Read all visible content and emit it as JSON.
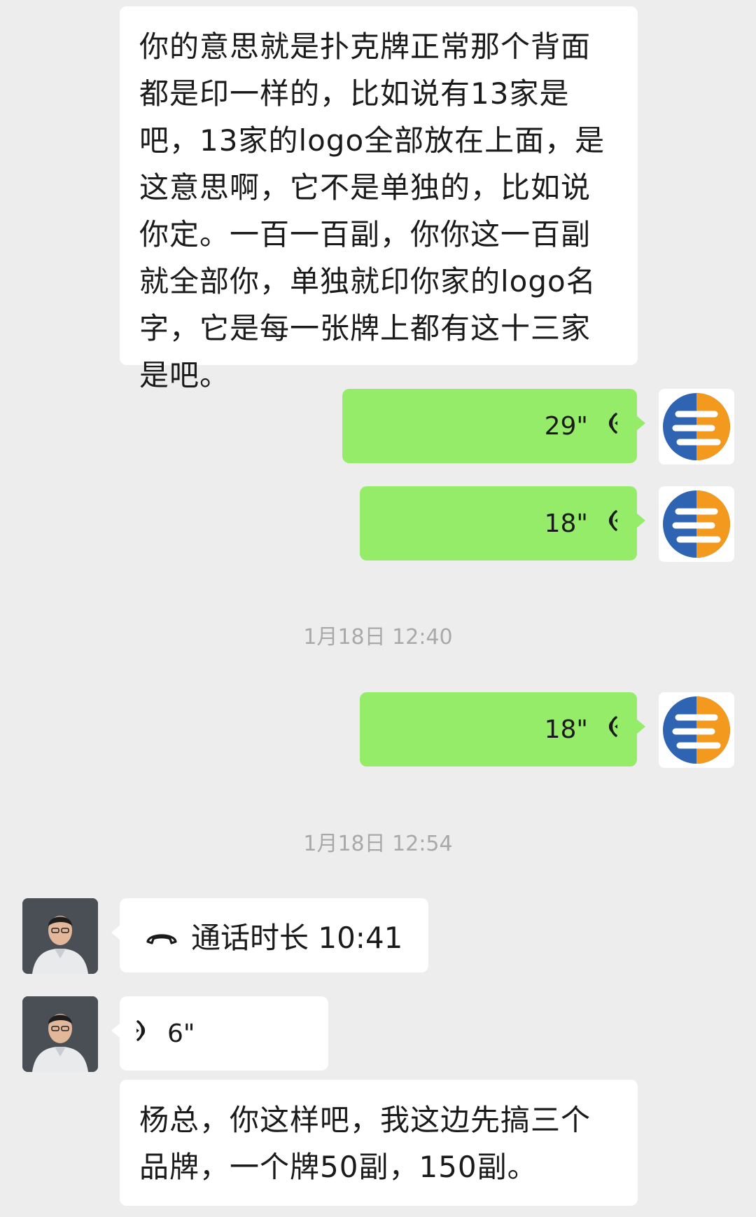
{
  "messages": {
    "m1_text": "你的意思就是扑克牌正常那个背面都是印一样的，比如说有13家是吧，13家的logo全部放在上面，是这意思啊，它不是单独的，比如说你定。一百一百副，你你这一百副就全部你，单独就印你家的logo名字，它是每一张牌上都有这十三家是吧。",
    "voice1_duration": "29\"",
    "voice2_duration": "18\"",
    "time1": "1月18日 12:40",
    "voice3_duration": "18\"",
    "time2": "1月18日 12:54",
    "call_label": "通话时长 10:41",
    "voice4_duration": "6\"",
    "m2_text": "杨总，你这样吧，我这边先搞三个品牌，一个牌50副，150副。"
  },
  "icons": {
    "voice": "voice-wave-icon",
    "phone": "phone-hangup-icon",
    "brand_logo": "brand-logo-icon",
    "person_avatar": "person-avatar"
  },
  "colors": {
    "background": "#ededed",
    "incoming_bubble": "#ffffff",
    "outgoing_bubble": "#95ec69",
    "timestamp_text": "#a9a9a9",
    "logo_blue": "#2f64b3",
    "logo_orange": "#f39a1e"
  }
}
